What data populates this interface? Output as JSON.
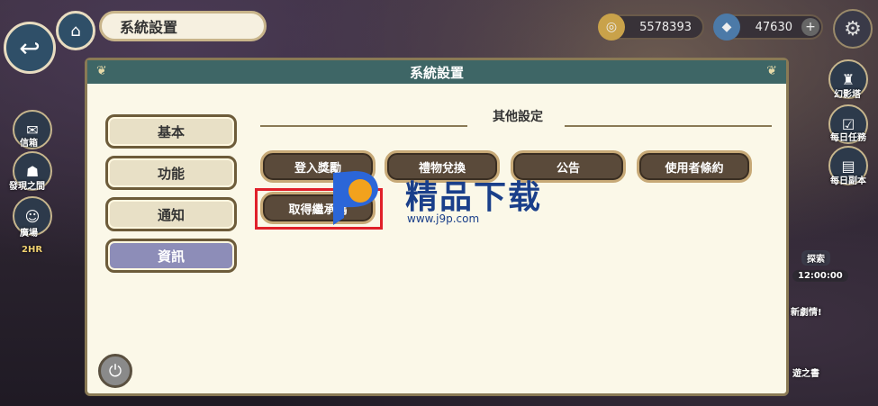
{
  "topbar": {
    "title": "系統設置",
    "gold": "5578393",
    "gems": "47630",
    "gem_add": "+"
  },
  "side_left": [
    "信箱",
    "發現之間",
    "廣場",
    "2HR"
  ],
  "side_right": [
    "幻影塔",
    "每日任務",
    "每日副本",
    "探索",
    "12:00:00",
    "新劇情!",
    "遊之書"
  ],
  "panel": {
    "header": "系統設置",
    "tabs": [
      "基本",
      "功能",
      "通知",
      "資訊"
    ],
    "active_tab": "資訊",
    "section_title": "其他設定",
    "buttons": [
      "登入獎勵",
      "禮物兌換",
      "公告",
      "使用者條約",
      "取得繼承碼"
    ]
  },
  "watermark": {
    "text": "精品下载",
    "url": "www.j9p.com"
  },
  "colors": {
    "header": "#3e6666",
    "panel_bg": "#fbf8e8",
    "active_tab": "#8d8db8",
    "highlight": "#e0202a"
  }
}
